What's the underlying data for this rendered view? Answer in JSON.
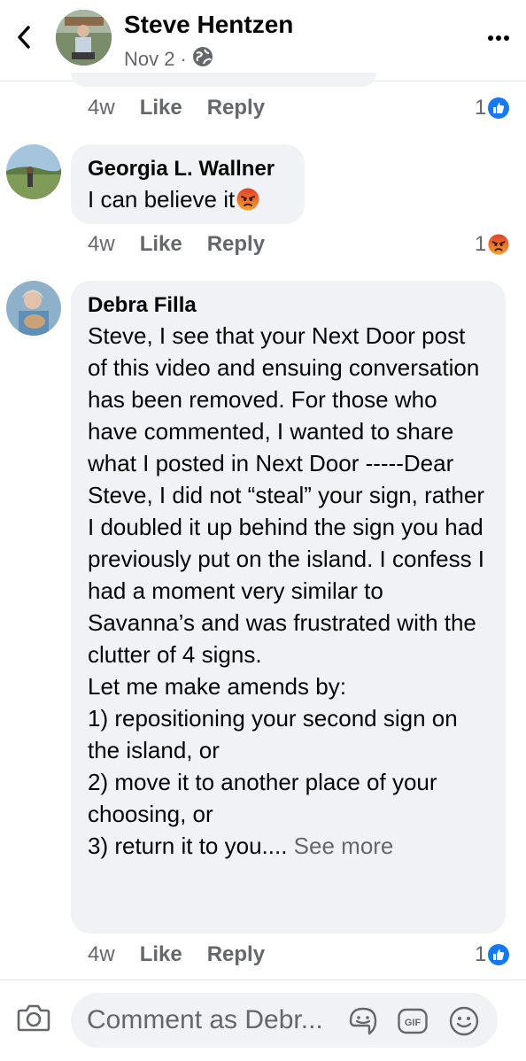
{
  "header": {
    "title": "Steve Hentzen",
    "date": "Nov 2",
    "separator": "·",
    "privacy_icon": "globe-icon"
  },
  "comments": [
    {
      "time": "4w",
      "like_label": "Like",
      "reply_label": "Reply",
      "reaction_count": "1",
      "reaction_icon": "like-icon"
    },
    {
      "author": "Georgia L. Wallner",
      "text": "I can believe it",
      "emoji": "angry-emoji",
      "time": "4w",
      "like_label": "Like",
      "reply_label": "Reply",
      "reaction_count": "1",
      "reaction_icon": "angry-icon"
    },
    {
      "author": "Debra Filla",
      "text": "Steve, I see that your Next Door post of this video and ensuing conversation has been removed. For those who have commented, I wanted to share what I posted in Next Door -----Dear Steve, I did not “steal” your sign, rather I doubled it up behind the sign you had previously put on the island. I confess I had a moment very similar to Savanna’s and was frustrated with the clutter of 4 signs.\nLet me make amends by:\n1) repositioning your second sign on the island, or\n2) move it to another place of your choosing, or\n3) return it to you....",
      "see_more": "See more",
      "time": "4w",
      "like_label": "Like",
      "reply_label": "Reply",
      "reaction_count": "1",
      "reaction_icon": "like-icon"
    }
  ],
  "composer": {
    "placeholder": "Comment as Debr...",
    "icons": [
      "camera-icon",
      "sticker-icon",
      "gif-icon",
      "emoji-icon"
    ]
  },
  "colors": {
    "like_blue": "#1877f2",
    "angry_orange": "#e9710f",
    "bubble_bg": "#f0f2f5",
    "secondary_text": "#65676b"
  }
}
